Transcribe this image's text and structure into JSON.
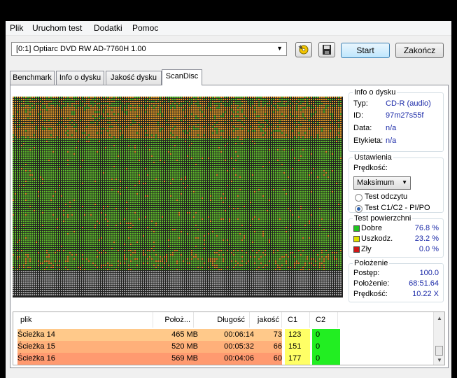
{
  "menu": [
    "Plik",
    "Uruchom test",
    "Dodatki",
    "Pomoc"
  ],
  "toolbar": {
    "drive": "[0:1]  Optiarc DVD RW AD-7760H 1.00",
    "start_label": "Start",
    "end_label": "Zakończ"
  },
  "tabs": [
    "Benchmark",
    "Info o dysku",
    "Jakość dysku",
    "ScanDisc"
  ],
  "active_tab": "ScanDisc",
  "disc_info": {
    "title": "Info o dysku",
    "type_label": "Typ:",
    "type_value": "CD-R (audio)",
    "id_label": "ID:",
    "id_value": "97m27s55f",
    "date_label": "Data:",
    "date_value": "n/a",
    "tag_label": "Etykieta:",
    "tag_value": "n/a"
  },
  "settings": {
    "title": "Ustawienia",
    "speed_label": "Prędkość:",
    "speed_value": "Maksimum",
    "radio_read": "Test odczytu",
    "radio_c1c2": "Test C1/C2 - PI/PO"
  },
  "surface": {
    "title": "Test powierzchni",
    "good_label": "Dobre",
    "good_value": "76.8 %",
    "damaged_label": "Uszkodz.",
    "damaged_value": "23.2 %",
    "bad_label": "Zły",
    "bad_value": "0.0 %",
    "colors": {
      "good": "#21c421",
      "damaged": "#e0e000",
      "bad": "#d01818"
    }
  },
  "position": {
    "title": "Położenie",
    "progress_label": "Postęp:",
    "progress_value": "100.0",
    "position_label": "Położenie:",
    "position_value": "68:51.64",
    "speed_label": "Prędkość:",
    "speed_value": "10.22 X"
  },
  "scan_map": {
    "colors": {
      "green": "#5fbe2a",
      "orange": "#e39a25",
      "gray": "#9a9a9a"
    },
    "green_fraction": 0.768
  },
  "table": {
    "headers": [
      "plik",
      "Położ...",
      "Długość",
      "jakość",
      "C1",
      "C2"
    ],
    "rows": [
      {
        "file": "Ścieżka 14",
        "pos": "465 MB",
        "length": "00:06:14",
        "quality": "73",
        "c1": "123",
        "c2": "0",
        "bg": "#ffc98a"
      },
      {
        "file": "Ścieżka 15",
        "pos": "520 MB",
        "length": "00:05:32",
        "quality": "66",
        "c1": "151",
        "c2": "0",
        "bg": "#ffb07a"
      },
      {
        "file": "Ścieżka 16",
        "pos": "569 MB",
        "length": "00:04:06",
        "quality": "60",
        "c1": "177",
        "c2": "0",
        "bg": "#ff9a70"
      }
    ],
    "c1_color": "#ffff66",
    "c2_color": "#22ee22"
  }
}
